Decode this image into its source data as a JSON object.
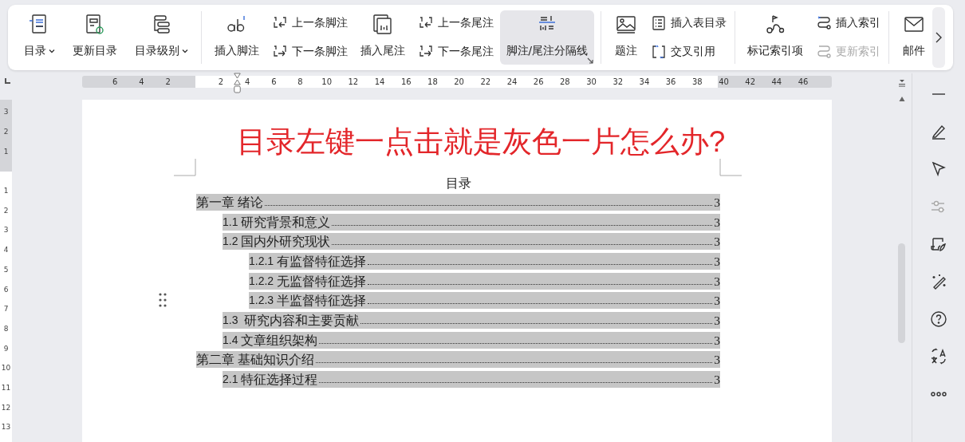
{
  "ribbon": {
    "groups": [
      {
        "columns": [
          {
            "kind": "large",
            "label": "目录",
            "dropdown": true,
            "selected": false
          },
          {
            "kind": "large",
            "label": "更新目录",
            "dropdown": false,
            "selected": false
          },
          {
            "kind": "large",
            "label": "目录级别",
            "dropdown": true,
            "selected": false
          }
        ]
      },
      {
        "columns": [
          {
            "kind": "large",
            "label": "插入脚注",
            "dropdown": false,
            "selected": false
          },
          {
            "kind": "stack",
            "items": [
              {
                "label": "上一条脚注",
                "disabled": false
              },
              {
                "label": "下一条脚注",
                "disabled": false
              }
            ]
          },
          {
            "kind": "large",
            "label": "插入尾注",
            "dropdown": false,
            "selected": false
          },
          {
            "kind": "stack",
            "items": [
              {
                "label": "上一条尾注",
                "disabled": false
              },
              {
                "label": "下一条尾注",
                "disabled": false
              }
            ]
          },
          {
            "kind": "large",
            "label": "脚注/尾注分隔线",
            "dropdown": false,
            "selected": true
          }
        ]
      },
      {
        "columns": [
          {
            "kind": "large",
            "label": "题注",
            "dropdown": false,
            "selected": false
          },
          {
            "kind": "stack",
            "items": [
              {
                "label": "插入表目录",
                "disabled": false
              },
              {
                "label": "交叉引用",
                "disabled": false
              }
            ]
          }
        ]
      },
      {
        "columns": [
          {
            "kind": "large",
            "label": "标记索引项",
            "dropdown": false,
            "selected": false
          },
          {
            "kind": "stack",
            "items": [
              {
                "label": "插入索引",
                "disabled": false
              },
              {
                "label": "更新索引",
                "disabled": true
              }
            ]
          }
        ]
      },
      {
        "columns": [
          {
            "kind": "large",
            "label": "邮件",
            "dropdown": false,
            "selected": false
          }
        ]
      }
    ]
  },
  "ruler": {
    "left_numbers": [
      "6",
      "4",
      "2"
    ],
    "numbers": [
      "2",
      "4",
      "6",
      "8",
      "10",
      "12",
      "14",
      "16",
      "18",
      "20",
      "22",
      "24",
      "26",
      "28",
      "30",
      "32",
      "34",
      "36",
      "38",
      "40",
      "42",
      "44",
      "46"
    ]
  },
  "vertical_ruler": {
    "top_numbers": [
      "3",
      "2",
      "1"
    ],
    "numbers": [
      "1",
      "2",
      "3",
      "4",
      "5",
      "6",
      "7",
      "8",
      "9",
      "10",
      "11",
      "12",
      "13"
    ]
  },
  "document": {
    "title": "目录左键一点击就是灰色一片怎么办?",
    "toc_heading": "目录",
    "toc": [
      {
        "number": "第一章",
        "title": "绪论",
        "page": "3",
        "children": [
          {
            "number": "1.1",
            "title": "研究背景和意义",
            "page": "3"
          },
          {
            "number": "1.2",
            "title": "国内外研究现状",
            "page": "3",
            "children": [
              {
                "number": "1.2.1",
                "title": "有监督特征选择",
                "page": "3"
              },
              {
                "number": "1.2.2",
                "title": "无监督特征选择",
                "page": "3"
              },
              {
                "number": "1.2.3",
                "title": "半监督特征选择",
                "page": "3"
              }
            ]
          },
          {
            "number": "1.3",
            "title": " 研究内容和主要贡献",
            "page": "3"
          },
          {
            "number": "1.4",
            "title": "文章组织架构",
            "page": "3"
          }
        ]
      },
      {
        "number": "第二章",
        "title": "基础知识介绍",
        "page": "3",
        "children": [
          {
            "number": "2.1",
            "title": "特征选择过程",
            "page": "3"
          }
        ]
      }
    ]
  }
}
